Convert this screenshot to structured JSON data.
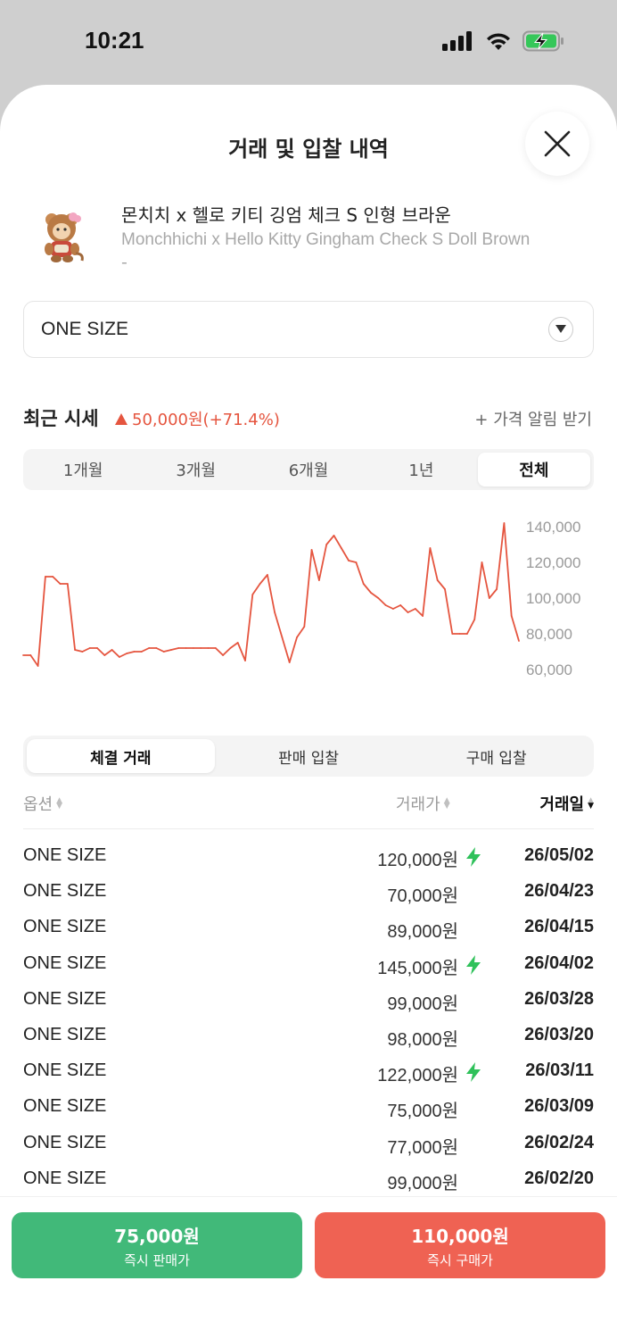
{
  "status": {
    "time": "10:21"
  },
  "sheet": {
    "title": "거래 및 입찰 내역"
  },
  "product": {
    "name_ko": "몬치치 x 헬로 키티 깅엄 체크 S 인형 브라운",
    "name_en": "Monchhichi x Hello Kitty Gingham Check S Doll Brown",
    "name_en_line2": "-"
  },
  "size_select": {
    "value": "ONE SIZE"
  },
  "market": {
    "title": "최근 시세",
    "change": "50,000원(+71.4%)",
    "change_direction": "up",
    "alert_label": "+ 가격 알림 받기"
  },
  "period_tabs": [
    "1개월",
    "3개월",
    "6개월",
    "1년",
    "전체"
  ],
  "period_active": "전체",
  "chart_data": {
    "type": "line",
    "series": [
      {
        "values": [
          68,
          68,
          62,
          112,
          112,
          108,
          108,
          71,
          70,
          72,
          72,
          68,
          71,
          67,
          69,
          70,
          70,
          72,
          72,
          70,
          71,
          72,
          72,
          72,
          72,
          72,
          72,
          68,
          72,
          75,
          65,
          102,
          108,
          113,
          92,
          78,
          64,
          78,
          84,
          127,
          110,
          130,
          135,
          128,
          121,
          120,
          108,
          103,
          100,
          96,
          94,
          96,
          92,
          94,
          90,
          128,
          110,
          105,
          80,
          80,
          80,
          88,
          120,
          100,
          105,
          142,
          90,
          76
        ]
      }
    ],
    "ylim": [
      55,
      150
    ],
    "yticks": [
      "140,000",
      "120,000",
      "100,000",
      "80,000",
      "60,000"
    ],
    "ytick_values": [
      140,
      120,
      100,
      80,
      60
    ],
    "color": "#e5553f"
  },
  "trade_tabs": [
    "체결 거래",
    "판매 입찰",
    "구매 입찰"
  ],
  "trade_active": "체결 거래",
  "table": {
    "headers": {
      "option": "옵션",
      "price": "거래가",
      "date": "거래일"
    },
    "rows": [
      {
        "option": "ONE SIZE",
        "price": "120,000원",
        "fast": true,
        "date": "26/05/02"
      },
      {
        "option": "ONE SIZE",
        "price": "70,000원",
        "fast": false,
        "date": "26/04/23"
      },
      {
        "option": "ONE SIZE",
        "price": "89,000원",
        "fast": false,
        "date": "26/04/15"
      },
      {
        "option": "ONE SIZE",
        "price": "145,000원",
        "fast": true,
        "date": "26/04/02"
      },
      {
        "option": "ONE SIZE",
        "price": "99,000원",
        "fast": false,
        "date": "26/03/28"
      },
      {
        "option": "ONE SIZE",
        "price": "98,000원",
        "fast": false,
        "date": "26/03/20"
      },
      {
        "option": "ONE SIZE",
        "price": "122,000원",
        "fast": true,
        "date": "26/03/11"
      },
      {
        "option": "ONE SIZE",
        "price": "75,000원",
        "fast": false,
        "date": "26/03/09"
      },
      {
        "option": "ONE SIZE",
        "price": "77,000원",
        "fast": false,
        "date": "26/02/24"
      },
      {
        "option": "ONE SIZE",
        "price": "99,000원",
        "fast": false,
        "date": "26/02/20"
      }
    ]
  },
  "actions": {
    "sell_price": "75,000원",
    "sell_label": "즉시 판매가",
    "buy_price": "110,000원",
    "buy_label": "즉시 구매가"
  },
  "colors": {
    "sell": "#41b979",
    "buy": "#ef6253",
    "accent_up": "#e5553f",
    "fast_bolt": "#2fc15a"
  },
  "icons": [
    "signal-icon",
    "wifi-icon",
    "battery-charging-icon",
    "close-icon",
    "chevron-down-icon",
    "up-triangle-icon",
    "sort-icon",
    "bolt-icon"
  ]
}
